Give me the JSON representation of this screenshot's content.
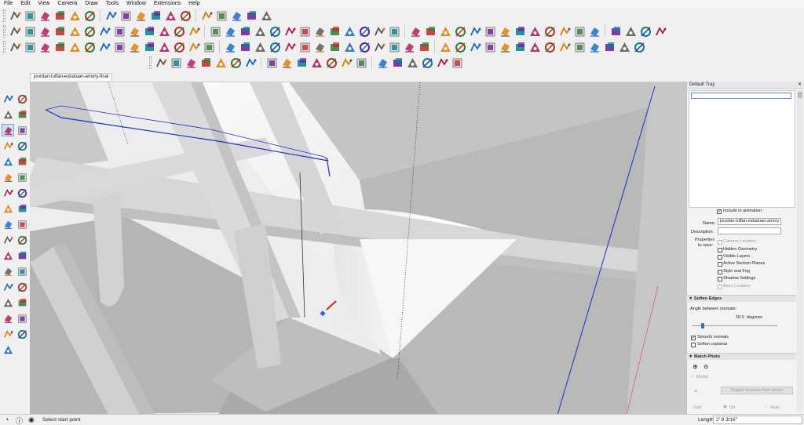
{
  "menu": [
    "File",
    "Edit",
    "View",
    "Camera",
    "Draw",
    "Tools",
    "Window",
    "Extensions",
    "Help"
  ],
  "document_tab": "jourdan-tuffan-esbatuan-amory-final",
  "toolbars": {
    "row1_icons": [
      "iso-view-icon",
      "top-view-icon",
      "front-view-icon",
      "right-view-icon",
      "back-view-icon",
      "left-view-icon",
      "section-plane-icon",
      "display-section-icon",
      "section-cut-icon",
      "solid-outer-shell-icon",
      "solid-intersect-icon",
      "solid-union-icon",
      "solid-subtract-icon",
      "solid-trim-icon",
      "solid-split-icon",
      "extension-warehouse-icon",
      "extension-manager-icon"
    ],
    "row2_icons": [
      "line-tool-icon",
      "freehand-icon",
      "arc-icon",
      "arc-2pt-icon",
      "arc-3pt-icon",
      "pie-icon",
      "rectangle-icon",
      "rotated-rect-icon",
      "circle-icon",
      "polygon-icon",
      "push-pull-icon",
      "follow-me-icon",
      "offset-icon",
      "move-icon",
      "rotate-icon",
      "scale-icon",
      "tape-icon",
      "protractor-icon",
      "dimension-icon",
      "text-icon",
      "axes-icon",
      "3d-text-icon",
      "orbit-icon",
      "pan-icon",
      "zoom-icon",
      "zoom-window-icon",
      "zoom-extents-icon",
      "walk-icon",
      "look-around-icon",
      "position-camera-icon",
      "sandbox-from-contours-icon",
      "sandbox-from-scratch-icon",
      "smoove-icon",
      "stamp-icon",
      "drape-icon",
      "add-detail-icon",
      "flip-edge-icon",
      "record-icon",
      "play-icon",
      "stop-icon",
      "rewind-icon",
      "camera-tripod-icon",
      "export-icon"
    ],
    "row3_icons": [
      "fredo-tool-1-icon",
      "fredo-tool-2-icon",
      "fredo-tool-3-icon",
      "fredo-tool-4-icon",
      "fredo-tool-5-icon",
      "fredo-tool-6-icon",
      "fredo-tool-7-icon",
      "fredo-tool-8-icon",
      "vray-1-icon",
      "vray-2-icon",
      "vray-3-icon",
      "vray-4-icon",
      "vray-5-icon",
      "vray-6-icon",
      "component-icon",
      "material-icon",
      "group-icon",
      "texture-icon",
      "render-icon",
      "play-animation-icon",
      "stop-animation-icon",
      "scene-icon",
      "tag-icon",
      "layer-icon",
      "settings-gear-icon",
      "style-icon",
      "edge-icon",
      "hidden-icon",
      "face-icon",
      "shadow-icon",
      "curve-icon",
      "join-icon",
      "split-icon",
      "extrude-icon",
      "profile-icon",
      "fillet-icon",
      "chamfer-icon",
      "bend-icon",
      "paint-icon",
      "shape-icon",
      "box-icon",
      "export-model-icon"
    ],
    "row4_icons": [
      "match-photo-icon",
      "teapot-icon",
      "camera-views-icon",
      "layers-panel-icon",
      "outliner-icon",
      "entity-info-icon",
      "lock-icon",
      "materials-icon",
      "components-icon",
      "sandbox-icon",
      "styles-icon",
      "fog-icon",
      "soften-icon",
      "protractor-2-icon",
      "triangle-icon",
      "rect-2-icon",
      "measure-icon",
      "sun-icon",
      "shadow-2-icon",
      "arrow-icon"
    ]
  },
  "left_palette_icons": [
    "select-icon",
    "eraser-icon",
    "paint-bucket-icon",
    "erase-icon",
    "pencil-icon",
    "freehand-icon",
    "rectangle-icon",
    "rotated-rectangle-icon",
    "circle-icon",
    "polygon-icon",
    "arc-icon",
    "pie-icon",
    "push-pull-icon",
    "follow-me-icon",
    "move-icon",
    "rotate-icon",
    "scale-icon",
    "offset-icon",
    "tape-measure-icon",
    "dimension-icon",
    "protractor-icon",
    "text-icon",
    "axes-icon",
    "3d-text-icon",
    "orbit-icon",
    "pan-icon",
    "zoom-icon",
    "zoom-window-icon",
    "walk-icon",
    "look-around-icon",
    "position-camera-icon",
    "section-plane-icon",
    "footprint-icon"
  ],
  "tray": {
    "title": "Default Tray",
    "scenes": {
      "include_in_animation": "Include in animation",
      "include_checked": true,
      "name_label": "Name:",
      "name_value": "jourdan-tuffan-esbatuan-amory",
      "description_label": "Description:",
      "description_value": "",
      "properties_label": "Properties",
      "to_save_label": "to save:",
      "properties": [
        {
          "label": "Camera Location",
          "checked": false,
          "disabled": true
        },
        {
          "label": "Hidden Geometry",
          "checked": false,
          "disabled": false
        },
        {
          "label": "Visible Layers",
          "checked": false,
          "disabled": false
        },
        {
          "label": "Active Section Planes",
          "checked": false,
          "disabled": false
        },
        {
          "label": "Style and Fog",
          "checked": false,
          "disabled": false
        },
        {
          "label": "Shadow Settings",
          "checked": false,
          "disabled": false
        },
        {
          "label": "Axes Location",
          "checked": false,
          "disabled": true
        }
      ]
    },
    "soften_edges": {
      "header": "Soften Edges",
      "angle_label": "Angle between normals:",
      "angle_value": "20.0",
      "angle_unit": "degrees",
      "smooth_normals": "Smooth normals",
      "smooth_checked": true,
      "soften_coplanar": "Soften coplanar",
      "coplanar_checked": false
    },
    "match_photo": {
      "header": "Match Photo",
      "model_label": "Model",
      "project_button": "Project textures from photo",
      "grid_label": "Grid",
      "grid_on": "On",
      "grid_auto": "Auto"
    }
  },
  "status": {
    "text": "Select start point",
    "measure_label": "Length",
    "measure_value": "2' 8 3/16\""
  },
  "colors": {
    "accent_blue": "#1f2ec9",
    "toolbar_bg": "#f0f0f0",
    "viewport_bg": "#ededed"
  }
}
